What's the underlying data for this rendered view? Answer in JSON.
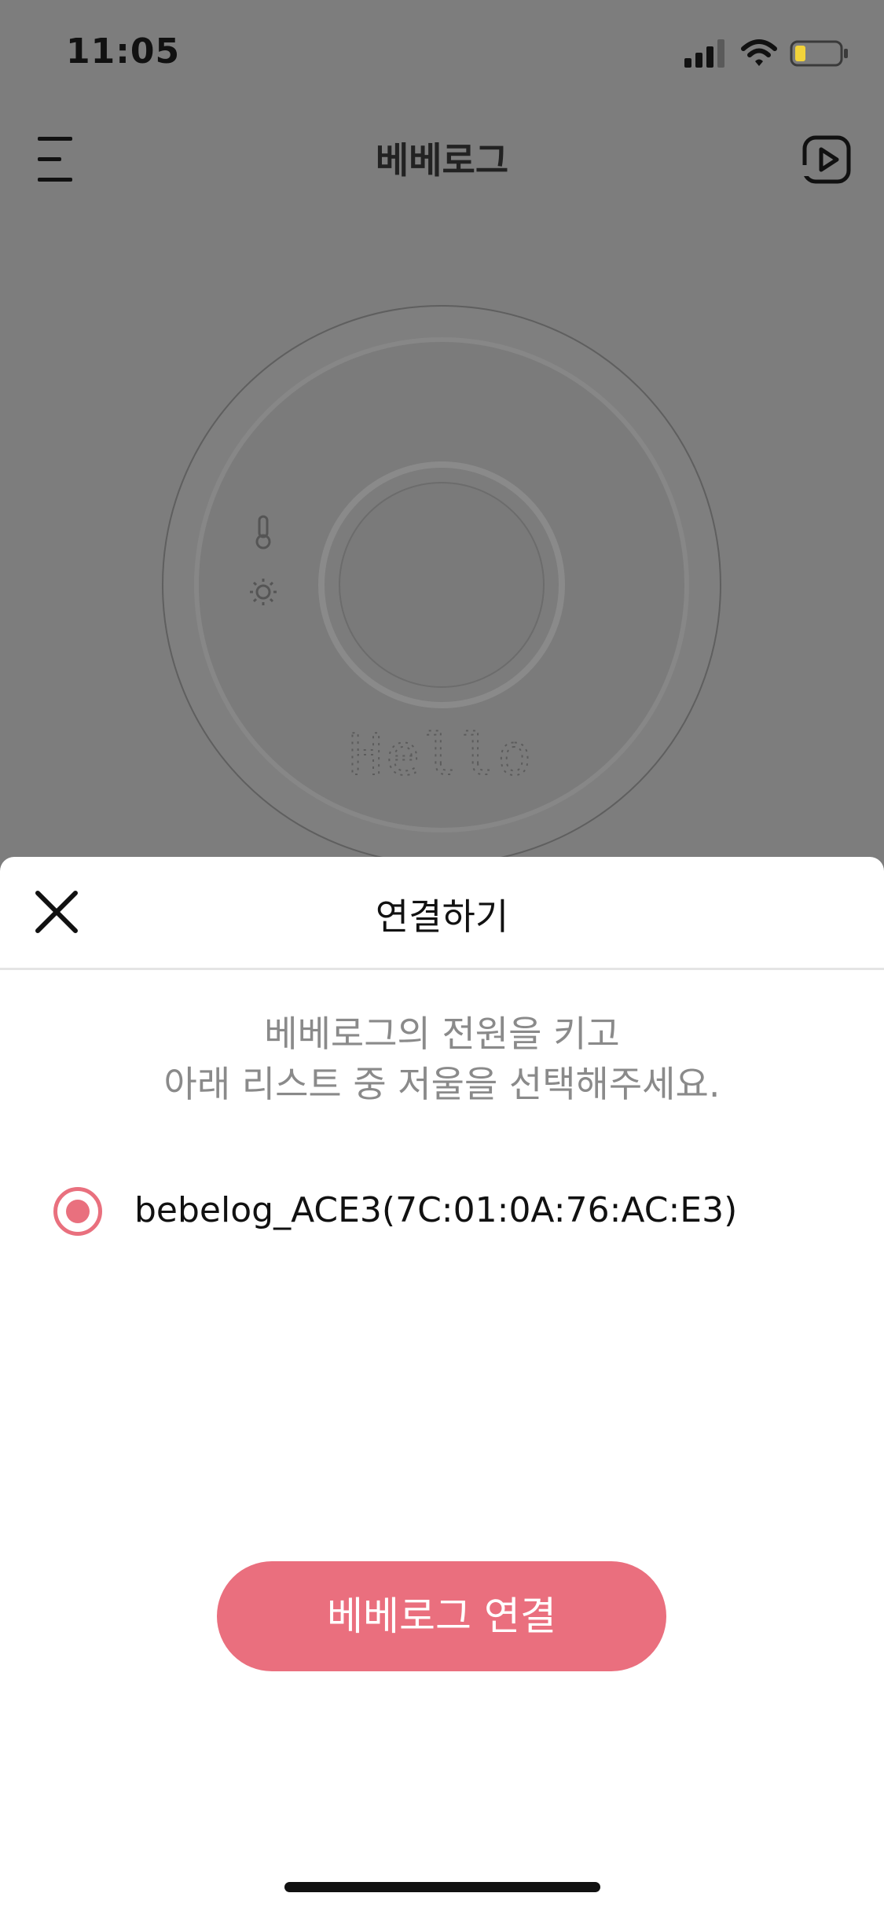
{
  "status_bar": {
    "time": "11:05",
    "icons": [
      "signal-icon",
      "wifi-icon",
      "battery-icon"
    ]
  },
  "header": {
    "title": "베베로그",
    "menu_icon": "menu-icon",
    "right_icon": "video-play-icon"
  },
  "device_display": {
    "text": "Hello",
    "icons": [
      "thermometer-icon",
      "sun-icon"
    ]
  },
  "sheet": {
    "title": "연결하기",
    "close_icon": "close-icon",
    "instruction_line1": "베베로그의 전원을 키고",
    "instruction_line2": "아래 리스트 중 저울을 선택해주세요.",
    "devices": [
      {
        "name": "bebelog_ACE3(7C:01:0A:76:AC:E3)",
        "selected": true
      }
    ],
    "connect_label": "베베로그 연결"
  },
  "colors": {
    "accent": "#ea6f7e",
    "overlay": "#7d7d7d",
    "instruction_text": "#8a8a8a"
  }
}
